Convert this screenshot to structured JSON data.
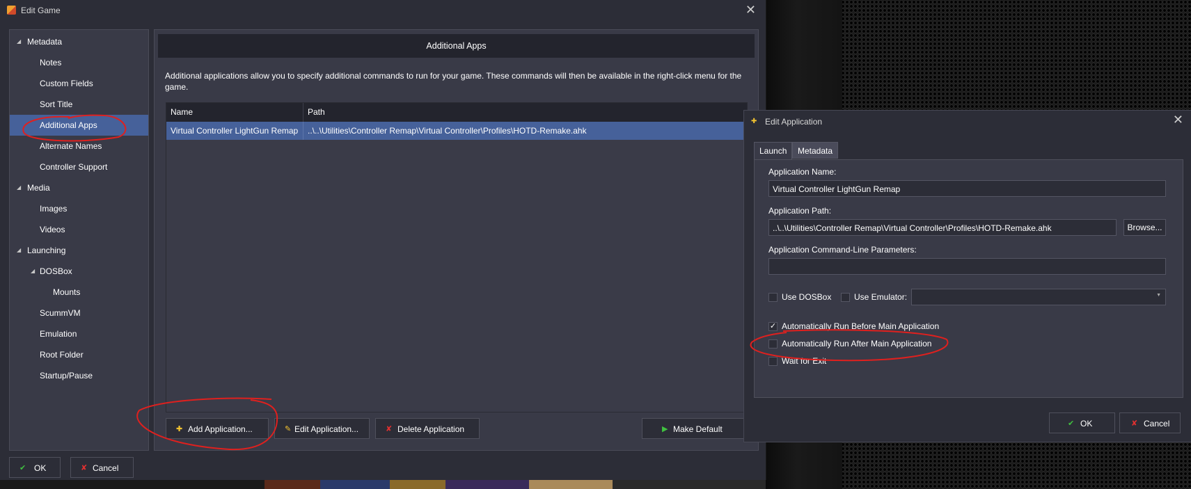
{
  "main_window": {
    "title": "Edit Game",
    "sidebar": {
      "items": [
        {
          "label": "Metadata",
          "level": 0,
          "expandable": true
        },
        {
          "label": "Notes",
          "level": 1
        },
        {
          "label": "Custom Fields",
          "level": 1
        },
        {
          "label": "Sort Title",
          "level": 1
        },
        {
          "label": "Additional Apps",
          "level": 1,
          "selected": true
        },
        {
          "label": "Alternate Names",
          "level": 1
        },
        {
          "label": "Controller Support",
          "level": 1
        },
        {
          "label": "Media",
          "level": 0,
          "expandable": true
        },
        {
          "label": "Images",
          "level": 1
        },
        {
          "label": "Videos",
          "level": 1
        },
        {
          "label": "Launching",
          "level": 0,
          "expandable": true
        },
        {
          "label": "DOSBox",
          "level": 1,
          "expandable": true
        },
        {
          "label": "Mounts",
          "level": 2
        },
        {
          "label": "ScummVM",
          "level": 1
        },
        {
          "label": "Emulation",
          "level": 1
        },
        {
          "label": "Root Folder",
          "level": 1
        },
        {
          "label": "Startup/Pause",
          "level": 1
        }
      ]
    },
    "panel": {
      "header": "Additional Apps",
      "description": "Additional applications allow you to specify additional commands to run for your game.  These commands will then be available in the right-click menu for the game.",
      "table": {
        "columns": [
          "Name",
          "Path"
        ],
        "rows": [
          {
            "name": "Virtual Controller LightGun Remap",
            "path": "..\\..\\Utilities\\Controller Remap\\Virtual Controller\\Profiles\\HOTD-Remake.ahk"
          }
        ]
      },
      "buttons": {
        "add": "Add Application...",
        "edit": "Edit Application...",
        "delete": "Delete Application",
        "make_default": "Make Default"
      }
    },
    "footer": {
      "ok": "OK",
      "cancel": "Cancel"
    }
  },
  "edit_application_dialog": {
    "title": "Edit Application",
    "tabs": [
      "Launch",
      "Metadata"
    ],
    "active_tab": "Launch",
    "application_name_label": "Application Name:",
    "application_name_value": "Virtual Controller LightGun Remap",
    "application_path_label": "Application Path:",
    "application_path_value": "..\\..\\Utilities\\Controller Remap\\Virtual Controller\\Profiles\\HOTD-Remake.ahk",
    "browse": "Browse...",
    "cmd_params_label": "Application Command-Line Parameters:",
    "cmd_params_value": "",
    "use_dosbox": {
      "label": "Use DOSBox",
      "checked": false
    },
    "use_emulator": {
      "label": "Use Emulator:",
      "checked": false,
      "selected": ""
    },
    "auto_run_before": {
      "label": "Automatically Run Before Main Application",
      "checked": true
    },
    "auto_run_after": {
      "label": "Automatically Run After Main Application",
      "checked": false
    },
    "wait_for_exit": {
      "label": "Wait for Exit",
      "checked": false
    },
    "ok": "OK",
    "cancel": "Cancel"
  },
  "colors": {
    "window_bg": "#2c2d37",
    "panel_bg": "#393a47",
    "selection": "#46619a",
    "annotation": "#e0201e"
  }
}
